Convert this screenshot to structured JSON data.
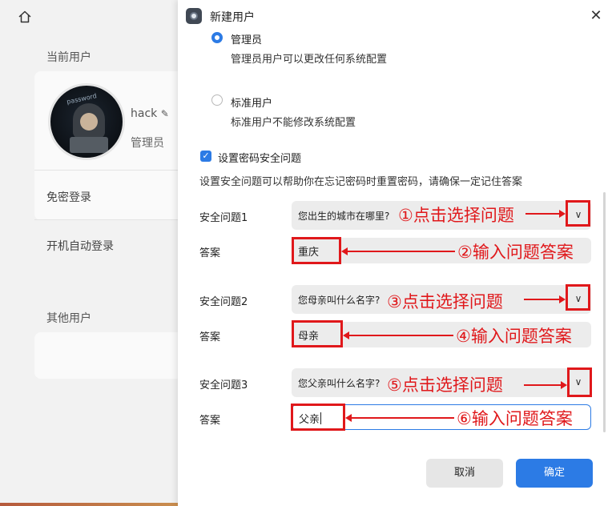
{
  "background": {
    "current_user_label": "当前用户",
    "username": "hack",
    "role": "管理员",
    "avatar_text": "password",
    "auto_login_no_pwd": "免密登录",
    "auto_login_boot": "开机自动登录",
    "other_users_label": "其他用户"
  },
  "dialog": {
    "title": "新建用户",
    "close_glyph": "✕",
    "admin_option": {
      "label": "管理员",
      "desc": "管理员用户可以更改任何系统配置"
    },
    "standard_option": {
      "label": "标准用户",
      "desc": "标准用户不能修改系统配置"
    },
    "security_checkbox_label": "设置密码安全问题",
    "help_text": "设置安全问题可以帮助你在忘记密码时重置密码，请确保一定记住答案",
    "questions": [
      {
        "label": "安全问题1",
        "value": "您出生的城市在哪里?",
        "answer_label": "答案",
        "answer": "重庆"
      },
      {
        "label": "安全问题2",
        "value": "您母亲叫什么名字?",
        "answer_label": "答案",
        "answer": "母亲"
      },
      {
        "label": "安全问题3",
        "value": "您父亲叫什么名字?",
        "answer_label": "答案",
        "answer": "父亲"
      }
    ],
    "cancel_label": "取消",
    "ok_label": "确定"
  },
  "annotations": [
    "①点击选择问题",
    "②输入问题答案",
    "③点击选择问题",
    "④输入问题答案",
    "⑤点击选择问题",
    "⑥输入问题答案"
  ],
  "colors": {
    "accent": "#2c7be5",
    "annotation": "#e0181b"
  }
}
